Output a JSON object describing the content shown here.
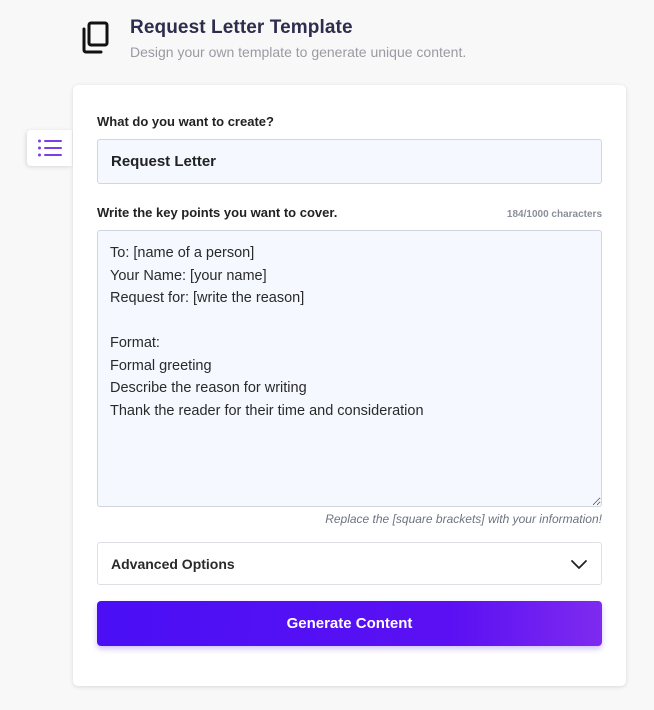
{
  "header": {
    "icon": "copy-documents-icon",
    "title": "Request Letter Template",
    "subtitle": "Design your own template to generate unique content."
  },
  "side_tab": {
    "icon": "list-icon",
    "accent_color": "#7b3fe4"
  },
  "form": {
    "title_label": "What do you want to create?",
    "title_value": "Request Letter",
    "points_label": "Write the key points you want to cover.",
    "char_count": "184/1000 characters",
    "points_value": "To: [name of a person]\nYour Name: [your name]\nRequest for: [write the reason]\n\nFormat:\nFormal greeting\nDescribe the reason for writing\nThank the reader for their time and consideration",
    "hint": "Replace the [square brackets] with your information!",
    "advanced_label": "Advanced Options",
    "advanced_icon": "chevron-down-icon",
    "generate_label": "Generate Content"
  },
  "colors": {
    "button_gradient_start": "#4a0ff5",
    "button_gradient_end": "#7e2af0",
    "input_background": "#f5f9ff"
  }
}
